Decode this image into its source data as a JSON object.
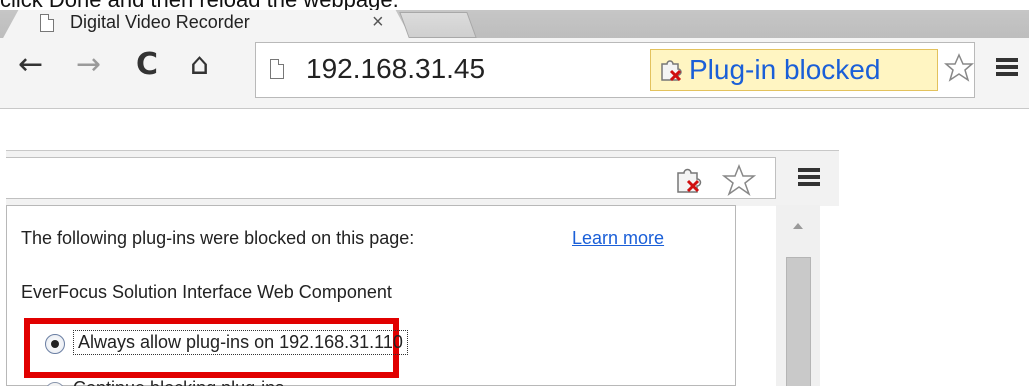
{
  "clipped_instruction": "click Done and then reload the webpage.",
  "browser": {
    "tab": {
      "title": "Digital Video Recorder",
      "close_glyph": "×"
    },
    "nav": {
      "back": "←",
      "forward": "→",
      "reload": "C",
      "home": "⌂"
    },
    "omnibox": {
      "url": "192.168.31.45"
    },
    "blocked_badge": {
      "label": "Plug-in blocked",
      "icon": "plugin-blocked-icon"
    },
    "colors": {
      "link": "#1a5fd8",
      "badge_bg": "#fff5c2",
      "highlight": "#e10000"
    }
  },
  "popup": {
    "heading": "The following plug-ins were blocked on this page:",
    "learn_more": "Learn more",
    "plugin_name": "EverFocus Solution Interface Web Component",
    "options": [
      {
        "label": "Always allow plug-ins on 192.168.31.110",
        "selected": true
      },
      {
        "label": "Continue blocking plug-ins",
        "selected": false
      }
    ]
  }
}
